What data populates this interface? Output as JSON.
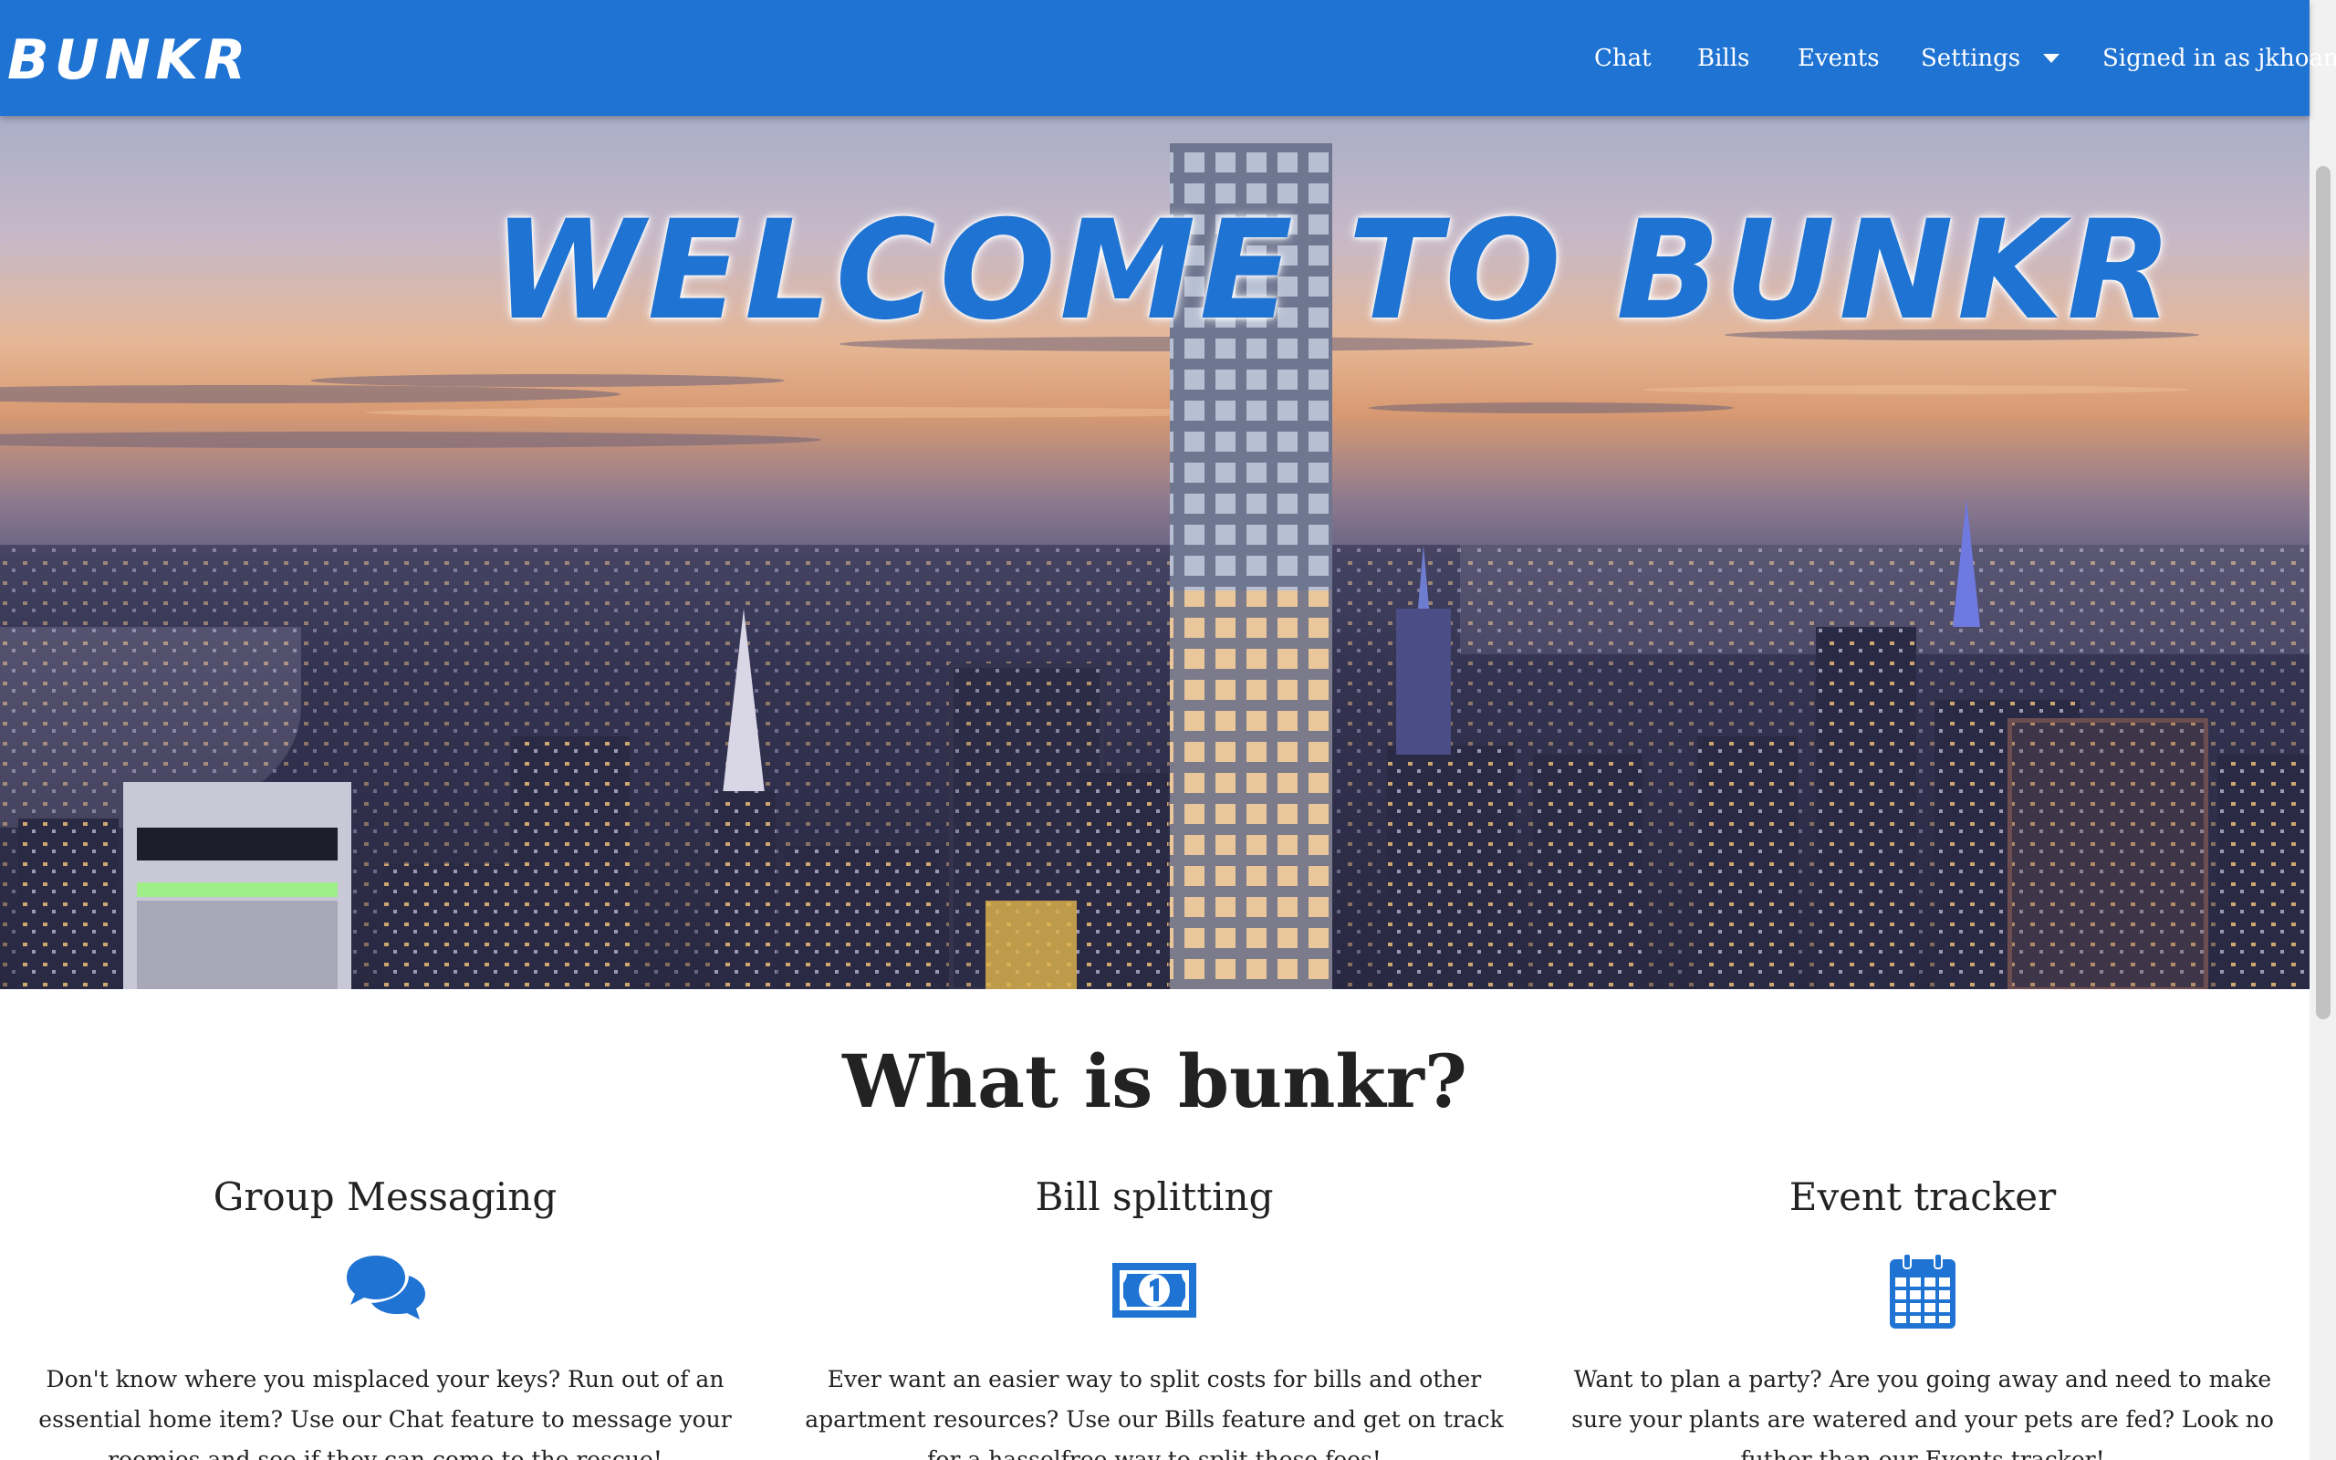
{
  "nav": {
    "brand": "BUNKR",
    "items": [
      "Chat",
      "Bills",
      "Events",
      "Settings"
    ],
    "user_label": "Signed in as jkhoang"
  },
  "hero": {
    "title": "WELCOME TO BUNKR"
  },
  "about": {
    "title": "What is bunkr?",
    "features": [
      {
        "title": "Group Messaging",
        "icon": "chat-bubbles-icon",
        "text": "Don't know where you misplaced your keys? Run out of an essential home item? Use our Chat feature to message your roomies and see if they can come to the rescue!"
      },
      {
        "title": "Bill splitting",
        "icon": "money-bill-icon",
        "text": "Ever want an easier way to split costs for bills and other apartment resources? Use our Bills feature and get on track for a hasselfree way to split these fees!"
      },
      {
        "title": "Event tracker",
        "icon": "calendar-icon",
        "text": "Want to plan a party? Are you going away and need to make sure your plants are watered and your pets are fed? Look no futher than our Events tracker!"
      }
    ]
  },
  "colors": {
    "brand_blue": "#1f73d3",
    "text": "#222222"
  }
}
